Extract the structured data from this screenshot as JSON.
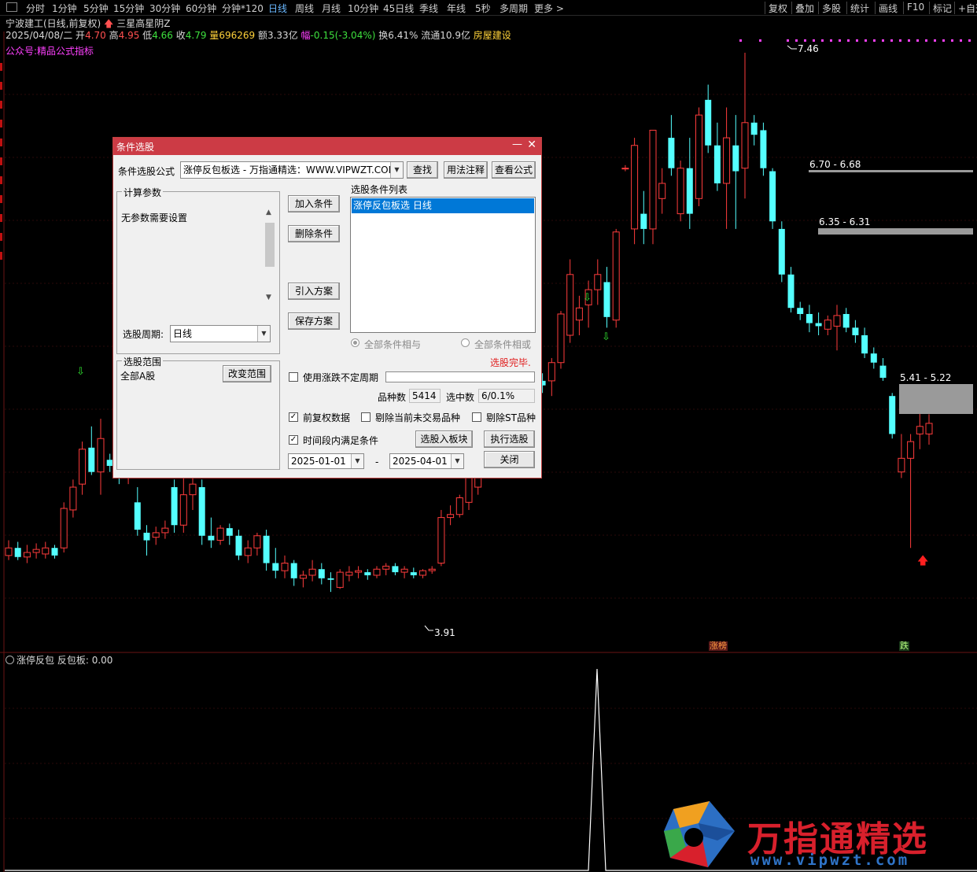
{
  "toolbar": {
    "periods": [
      "分时",
      "1分钟",
      "5分钟",
      "15分钟",
      "30分钟",
      "60分钟",
      "分钟*120",
      "日线",
      "周线",
      "月线",
      "10分钟",
      "45日线",
      "季线",
      "年线",
      "5秒",
      "多周期",
      "更多 >"
    ],
    "active_period": "日线",
    "right_items": [
      "复权",
      "叠加",
      "多股",
      "统计",
      "画线",
      "F10",
      "标记",
      "+自选"
    ]
  },
  "stock": {
    "name": "宁波建工(日线,前复权)",
    "pattern": "三星高星阴Z",
    "date": "2025/04/08/二",
    "open_label": "开",
    "open": "4.70",
    "high_label": "高",
    "high": "4.95",
    "low_label": "低",
    "low": "4.66",
    "close_label": "收",
    "close": "4.79",
    "vol_label": "量",
    "vol": "696269",
    "amt_label": "额",
    "amt": "3.33亿",
    "chg_label": "幅",
    "chg": "-0.15(-3.04%)",
    "turnover_label": "换",
    "turnover": "6.41%",
    "float_label": "流通",
    "float": "10.9亿",
    "sector": "房屋建设",
    "indicator": "公众号:精品公式指标"
  },
  "price_labels": {
    "high": "7.46",
    "low": "3.91",
    "zone1": "6.70 - 6.68",
    "zone2": "6.35 - 6.31",
    "zone3": "5.41 - 5.22"
  },
  "tags": {
    "up": "涨榜",
    "down": "跌"
  },
  "lower_panel": {
    "title": "涨停反包",
    "value_label": "反包板:",
    "value": "0.00"
  },
  "dialog": {
    "title": "条件选股",
    "formula_label": "条件选股公式",
    "formula_value": "涨停反包板选  -  万指通精选：WWW.VIPWZT.COM",
    "find_btn": "查找",
    "usage_btn": "用法注释",
    "view_btn": "查看公式",
    "params_group": "计算参数",
    "params_text": "无参数需要设置",
    "period_label": "选股周期:",
    "period_value": "日线",
    "scope_group": "选股范围",
    "scope_value": "全部A股",
    "change_scope_btn": "改变范围",
    "add_btn": "加入条件",
    "del_btn": "删除条件",
    "import_btn": "引入方案",
    "save_btn": "保存方案",
    "list_label": "选股条件列表",
    "list_item": "涨停反包板选  日线",
    "radio_and": "全部条件相与",
    "radio_or": "全部条件相或",
    "status": "选股完毕.",
    "uncertain_period": "使用涨跌不定周期",
    "count_label": "品种数",
    "count_value": "5414",
    "selected_label": "选中数",
    "selected_value": "6/0.1%",
    "chk_restore": "前复权数据",
    "chk_exclude_untraded": "剔除当前未交易品种",
    "chk_exclude_st": "剔除ST品种",
    "chk_period": "时间段内满足条件",
    "to_block_btn": "选股入板块",
    "run_btn": "执行选股",
    "date_from": "2025-01-01",
    "date_to": "2025-04-01",
    "date_sep": "-",
    "close_btn": "关闭"
  },
  "logo": {
    "cn": "万指通精选",
    "url": "www.vipwzt.com"
  },
  "colors": {
    "up": "#ff3c3c",
    "down": "#54ffff",
    "accent": "#cc3b45",
    "select": "#0078d7"
  },
  "chart_data": {
    "type": "candlestick",
    "ylim": [
      3.6,
      7.6
    ],
    "candles": [
      {
        "o": 4.15,
        "h": 4.25,
        "l": 4.12,
        "c": 4.2
      },
      {
        "o": 4.2,
        "h": 4.24,
        "l": 4.12,
        "c": 4.14
      },
      {
        "o": 4.14,
        "h": 4.22,
        "l": 4.1,
        "c": 4.17
      },
      {
        "o": 4.17,
        "h": 4.23,
        "l": 4.13,
        "c": 4.19
      },
      {
        "o": 4.16,
        "h": 4.24,
        "l": 4.13,
        "c": 4.2
      },
      {
        "o": 4.2,
        "h": 4.22,
        "l": 4.13,
        "c": 4.15
      },
      {
        "o": 4.2,
        "h": 4.5,
        "l": 4.17,
        "c": 4.46
      },
      {
        "o": 4.45,
        "h": 4.65,
        "l": 4.4,
        "c": 4.6
      },
      {
        "o": 4.62,
        "h": 4.9,
        "l": 4.55,
        "c": 4.85
      },
      {
        "o": 4.86,
        "h": 5.0,
        "l": 4.68,
        "c": 4.7
      },
      {
        "o": 4.7,
        "h": 5.05,
        "l": 4.55,
        "c": 4.92
      },
      {
        "o": 4.78,
        "h": 4.82,
        "l": 4.7,
        "c": 4.74
      },
      {
        "o": 4.72,
        "h": 4.76,
        "l": 4.62,
        "c": 4.68
      },
      {
        "o": 4.7,
        "h": 4.9,
        "l": 4.62,
        "c": 4.82
      },
      {
        "o": 4.5,
        "h": 4.6,
        "l": 4.28,
        "c": 4.32
      },
      {
        "o": 4.3,
        "h": 4.35,
        "l": 4.15,
        "c": 4.25
      },
      {
        "o": 4.27,
        "h": 4.34,
        "l": 4.22,
        "c": 4.3
      },
      {
        "o": 4.3,
        "h": 4.38,
        "l": 4.26,
        "c": 4.33
      },
      {
        "o": 4.6,
        "h": 4.65,
        "l": 4.3,
        "c": 4.35
      },
      {
        "o": 4.35,
        "h": 4.7,
        "l": 4.3,
        "c": 4.55
      },
      {
        "o": 4.55,
        "h": 4.66,
        "l": 4.45,
        "c": 4.62
      },
      {
        "o": 4.6,
        "h": 4.65,
        "l": 4.22,
        "c": 4.28
      },
      {
        "o": 4.28,
        "h": 4.4,
        "l": 4.2,
        "c": 4.25
      },
      {
        "o": 4.25,
        "h": 4.35,
        "l": 4.22,
        "c": 4.33
      },
      {
        "o": 4.33,
        "h": 4.36,
        "l": 4.22,
        "c": 4.28
      },
      {
        "o": 4.28,
        "h": 4.32,
        "l": 4.12,
        "c": 4.15
      },
      {
        "o": 4.15,
        "h": 4.25,
        "l": 4.1,
        "c": 4.2
      },
      {
        "o": 4.2,
        "h": 4.3,
        "l": 4.15,
        "c": 4.28
      },
      {
        "o": 4.28,
        "h": 4.32,
        "l": 4.05,
        "c": 4.1
      },
      {
        "o": 4.1,
        "h": 4.2,
        "l": 4.0,
        "c": 4.05
      },
      {
        "o": 4.05,
        "h": 4.15,
        "l": 4.0,
        "c": 4.1
      },
      {
        "o": 4.1,
        "h": 4.12,
        "l": 3.95,
        "c": 4.0
      },
      {
        "o": 4.0,
        "h": 4.05,
        "l": 3.94,
        "c": 4.02
      },
      {
        "o": 4.02,
        "h": 4.12,
        "l": 3.98,
        "c": 4.06
      },
      {
        "o": 4.06,
        "h": 4.1,
        "l": 3.96,
        "c": 4.0
      },
      {
        "o": 4.0,
        "h": 4.04,
        "l": 3.91,
        "c": 3.99
      },
      {
        "o": 3.94,
        "h": 4.06,
        "l": 3.93,
        "c": 4.04
      },
      {
        "o": 4.02,
        "h": 4.08,
        "l": 3.98,
        "c": 4.04
      },
      {
        "o": 4.04,
        "h": 4.08,
        "l": 4.0,
        "c": 4.05
      },
      {
        "o": 4.04,
        "h": 4.06,
        "l": 3.99,
        "c": 4.02
      },
      {
        "o": 4.02,
        "h": 4.08,
        "l": 4.0,
        "c": 4.06
      },
      {
        "o": 4.06,
        "h": 4.1,
        "l": 4.02,
        "c": 4.08
      },
      {
        "o": 4.08,
        "h": 4.1,
        "l": 4.02,
        "c": 4.04
      },
      {
        "o": 4.04,
        "h": 4.08,
        "l": 4.0,
        "c": 4.06
      },
      {
        "o": 4.04,
        "h": 4.07,
        "l": 4.0,
        "c": 4.02
      },
      {
        "o": 4.02,
        "h": 4.06,
        "l": 4.0,
        "c": 4.05
      },
      {
        "o": 4.05,
        "h": 4.08,
        "l": 4.03,
        "c": 4.06
      },
      {
        "o": 4.1,
        "h": 4.45,
        "l": 4.08,
        "c": 4.4
      },
      {
        "o": 4.4,
        "h": 4.48,
        "l": 4.35,
        "c": 4.42
      },
      {
        "o": 4.42,
        "h": 4.55,
        "l": 4.4,
        "c": 4.53
      },
      {
        "o": 4.5,
        "h": 4.7,
        "l": 4.45,
        "c": 4.68
      },
      {
        "o": 4.6,
        "h": 4.78,
        "l": 4.55,
        "c": 4.72
      },
      {
        "o": 4.72,
        "h": 4.85,
        "l": 4.68,
        "c": 4.78
      },
      {
        "o": 4.78,
        "h": 5.22,
        "l": 4.75,
        "c": 5.2
      },
      {
        "o": 5.2,
        "h": 5.92,
        "l": 5.18,
        "c": 5.9
      },
      {
        "o": 5.9,
        "h": 5.96,
        "l": 5.2,
        "c": 5.3
      },
      {
        "o": 5.3,
        "h": 5.65,
        "l": 5.2,
        "c": 5.45
      },
      {
        "o": 5.4,
        "h": 5.5,
        "l": 5.25,
        "c": 5.3
      },
      {
        "o": 5.3,
        "h": 5.35,
        "l": 5.22,
        "c": 5.27
      },
      {
        "o": 5.3,
        "h": 5.45,
        "l": 5.2,
        "c": 5.42
      },
      {
        "o": 5.42,
        "h": 5.76,
        "l": 5.38,
        "c": 5.74
      },
      {
        "o": 5.6,
        "h": 6.1,
        "l": 5.55,
        "c": 6.0
      },
      {
        "o": 5.7,
        "h": 5.86,
        "l": 5.6,
        "c": 5.78
      },
      {
        "o": 5.8,
        "h": 5.96,
        "l": 5.65,
        "c": 5.9
      },
      {
        "o": 5.9,
        "h": 6.1,
        "l": 5.8,
        "c": 6.0
      },
      {
        "o": 5.95,
        "h": 6.05,
        "l": 5.65,
        "c": 5.72
      },
      {
        "o": 5.7,
        "h": 6.3,
        "l": 5.65,
        "c": 6.28
      },
      {
        "o": 6.7,
        "h": 6.72,
        "l": 6.68,
        "c": 6.7
      },
      {
        "o": 6.3,
        "h": 6.9,
        "l": 6.2,
        "c": 6.85
      },
      {
        "o": 6.4,
        "h": 6.55,
        "l": 6.2,
        "c": 6.3
      },
      {
        "o": 6.3,
        "h": 6.95,
        "l": 6.2,
        "c": 6.95
      },
      {
        "o": 6.5,
        "h": 6.7,
        "l": 6.4,
        "c": 6.6
      },
      {
        "o": 6.9,
        "h": 7.05,
        "l": 6.65,
        "c": 6.7
      },
      {
        "o": 6.4,
        "h": 6.75,
        "l": 6.35,
        "c": 6.7
      },
      {
        "o": 6.7,
        "h": 6.9,
        "l": 6.3,
        "c": 6.4
      },
      {
        "o": 6.5,
        "h": 7.1,
        "l": 6.45,
        "c": 7.05
      },
      {
        "o": 7.15,
        "h": 7.25,
        "l": 6.8,
        "c": 6.85
      },
      {
        "o": 6.85,
        "h": 7.0,
        "l": 6.55,
        "c": 6.6
      },
      {
        "o": 6.6,
        "h": 7.1,
        "l": 6.3,
        "c": 6.9
      },
      {
        "o": 6.85,
        "h": 7.05,
        "l": 6.3,
        "c": 6.68
      },
      {
        "o": 6.7,
        "h": 7.46,
        "l": 6.5,
        "c": 7.0
      },
      {
        "o": 7.0,
        "h": 7.05,
        "l": 6.85,
        "c": 6.92
      },
      {
        "o": 6.95,
        "h": 7.0,
        "l": 6.65,
        "c": 6.7
      },
      {
        "o": 6.68,
        "h": 6.7,
        "l": 6.3,
        "c": 6.35
      },
      {
        "o": 6.3,
        "h": 6.35,
        "l": 5.95,
        "c": 6.0
      },
      {
        "o": 6.0,
        "h": 6.05,
        "l": 5.75,
        "c": 5.78
      },
      {
        "o": 5.78,
        "h": 5.82,
        "l": 5.7,
        "c": 5.74
      },
      {
        "o": 5.74,
        "h": 5.8,
        "l": 5.62,
        "c": 5.68
      },
      {
        "o": 5.68,
        "h": 5.75,
        "l": 5.6,
        "c": 5.66
      },
      {
        "o": 5.64,
        "h": 5.73,
        "l": 5.6,
        "c": 5.7
      },
      {
        "o": 5.66,
        "h": 5.8,
        "l": 5.5,
        "c": 5.73
      },
      {
        "o": 5.74,
        "h": 5.78,
        "l": 5.62,
        "c": 5.65
      },
      {
        "o": 5.65,
        "h": 5.7,
        "l": 5.55,
        "c": 5.6
      },
      {
        "o": 5.6,
        "h": 5.65,
        "l": 5.45,
        "c": 5.48
      },
      {
        "o": 5.48,
        "h": 5.52,
        "l": 5.38,
        "c": 5.42
      },
      {
        "o": 5.4,
        "h": 5.45,
        "l": 5.3,
        "c": 5.32
      },
      {
        "o": 5.2,
        "h": 5.22,
        "l": 4.92,
        "c": 4.95
      },
      {
        "o": 4.7,
        "h": 4.95,
        "l": 4.66,
        "c": 4.79
      },
      {
        "o": 4.79,
        "h": 4.95,
        "l": 4.2,
        "c": 4.9
      },
      {
        "o": 4.95,
        "h": 5.15,
        "l": 4.85,
        "c": 5.0
      },
      {
        "o": 4.95,
        "h": 5.08,
        "l": 4.88,
        "c": 5.02
      }
    ],
    "indicator_series": {
      "name": "反包板",
      "value": 0.0
    }
  }
}
